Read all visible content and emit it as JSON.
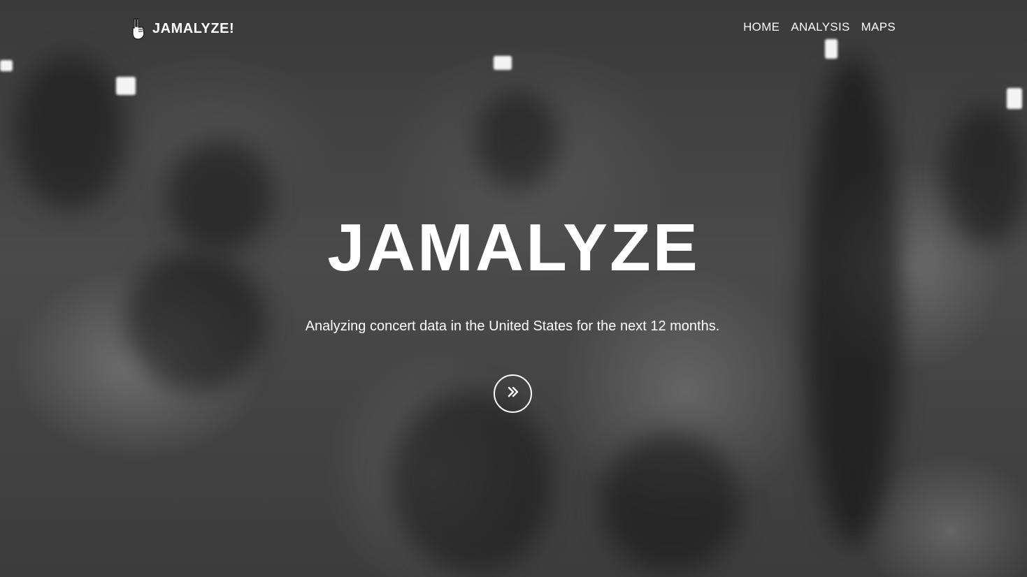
{
  "navbar": {
    "brand_icon": "rock-hand-icon",
    "brand_label": "JAMALYZE!",
    "links": [
      {
        "label": "HOME"
      },
      {
        "label": "ANALYSIS"
      },
      {
        "label": "MAPS"
      }
    ]
  },
  "hero": {
    "title": "JAMALYZE",
    "subtitle": "Analyzing concert data in the United States for the next 12 months.",
    "scroll_icon": "double-chevron-right-icon",
    "background": "grayscale-concert-crowd-photo"
  },
  "colors": {
    "text": "#ffffff",
    "background_dark": "#3a3a3a"
  }
}
